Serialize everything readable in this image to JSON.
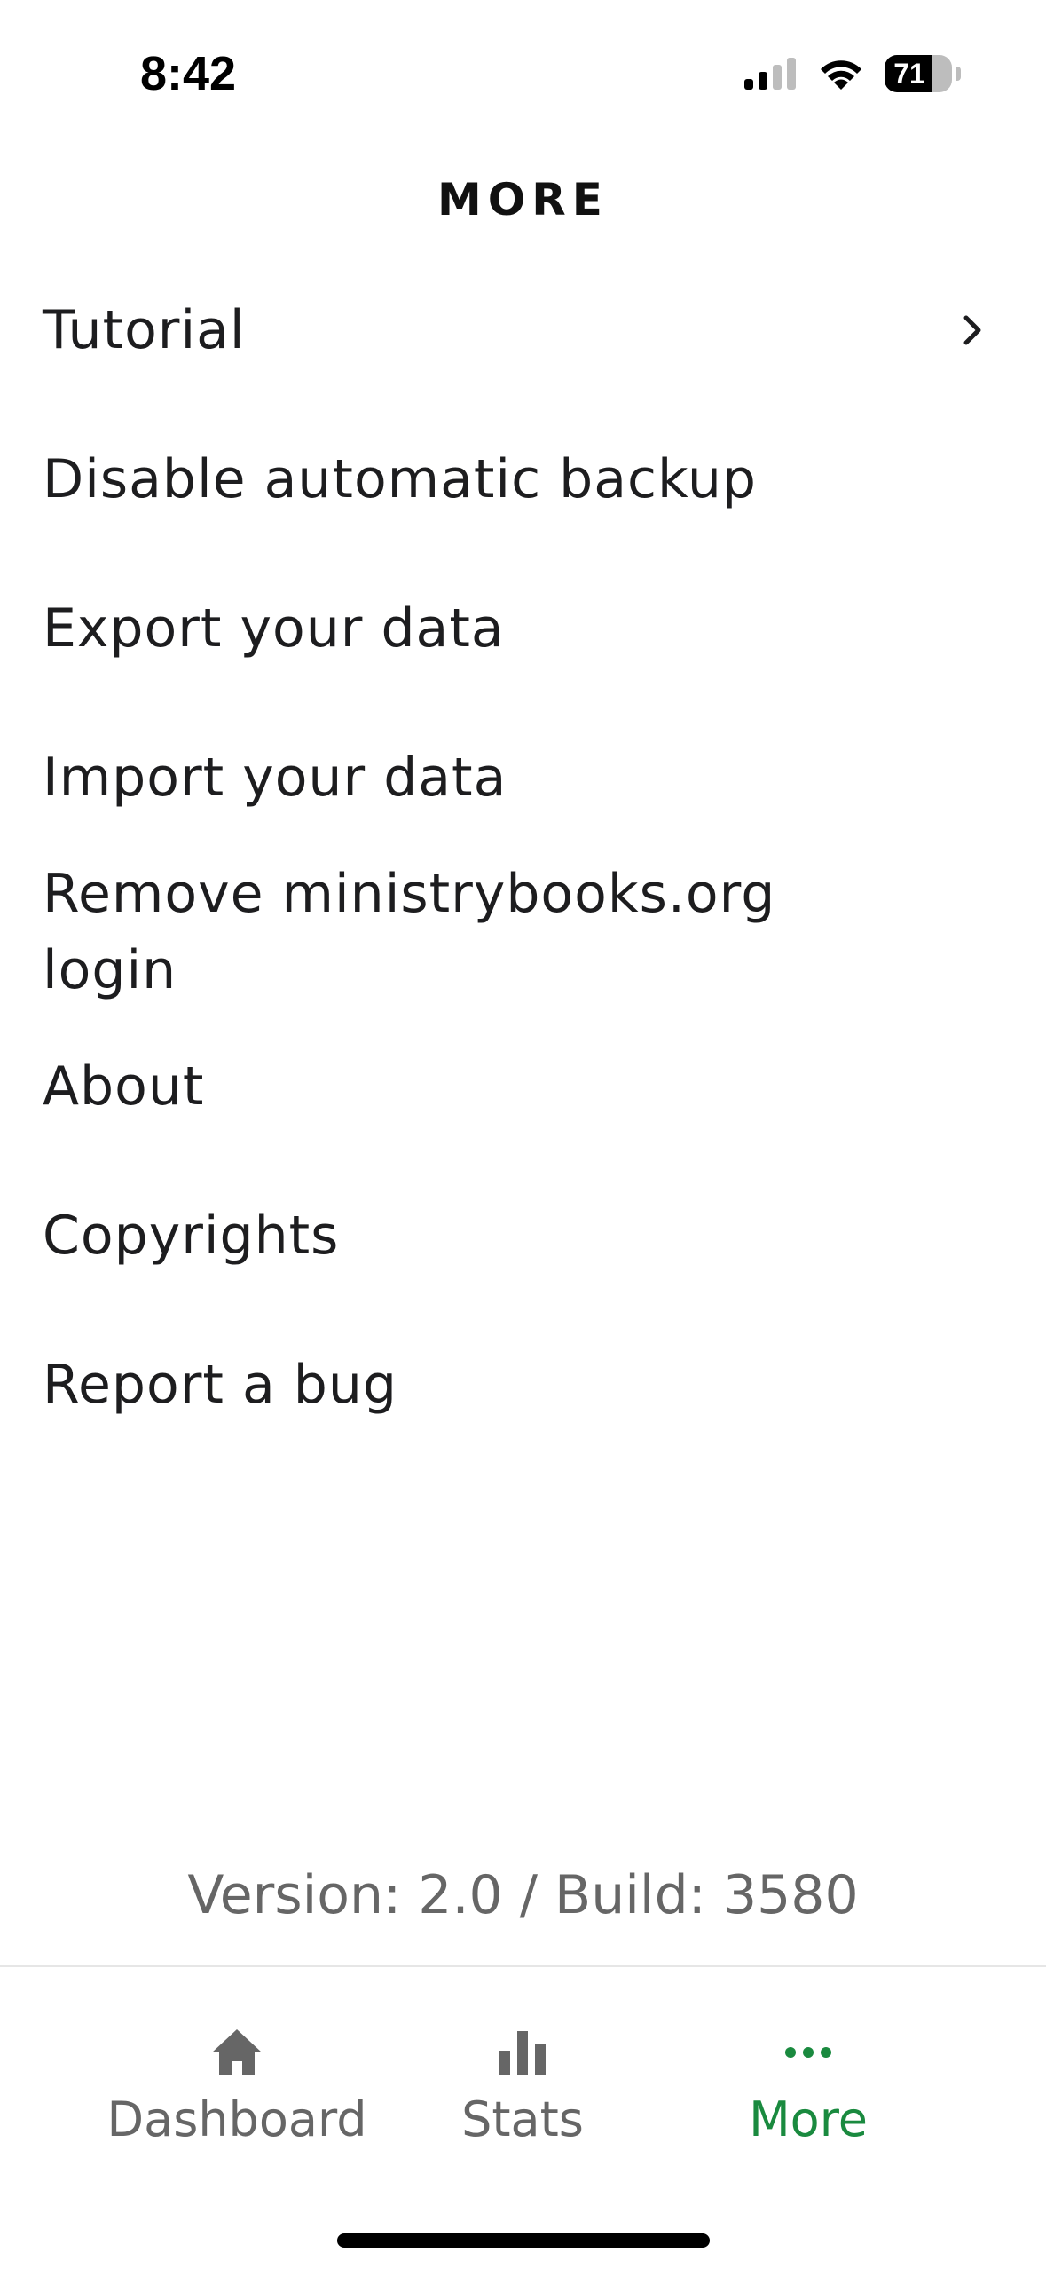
{
  "status": {
    "time": "8:42",
    "battery": "71",
    "battery_level": 0.71
  },
  "header": {
    "title": "MORE"
  },
  "menu": {
    "items": [
      {
        "label": "Tutorial"
      },
      {
        "label": "Disable automatic backup"
      },
      {
        "label": "Export your data"
      },
      {
        "label": "Import your data"
      },
      {
        "label": "Remove ministrybooks.org login"
      },
      {
        "label": "About"
      },
      {
        "label": "Copyrights"
      },
      {
        "label": "Report a bug"
      }
    ]
  },
  "footer": {
    "version": "Version: 2.0 / Build: 3580"
  },
  "tabbar": {
    "tabs": [
      {
        "label": "Dashboard",
        "icon": "home-icon"
      },
      {
        "label": "Stats",
        "icon": "bar-chart-icon"
      },
      {
        "label": "More",
        "icon": "more-dots-icon"
      }
    ],
    "active": "More"
  },
  "colors": {
    "accent": "#1a8a3f",
    "inactive": "#666666"
  }
}
